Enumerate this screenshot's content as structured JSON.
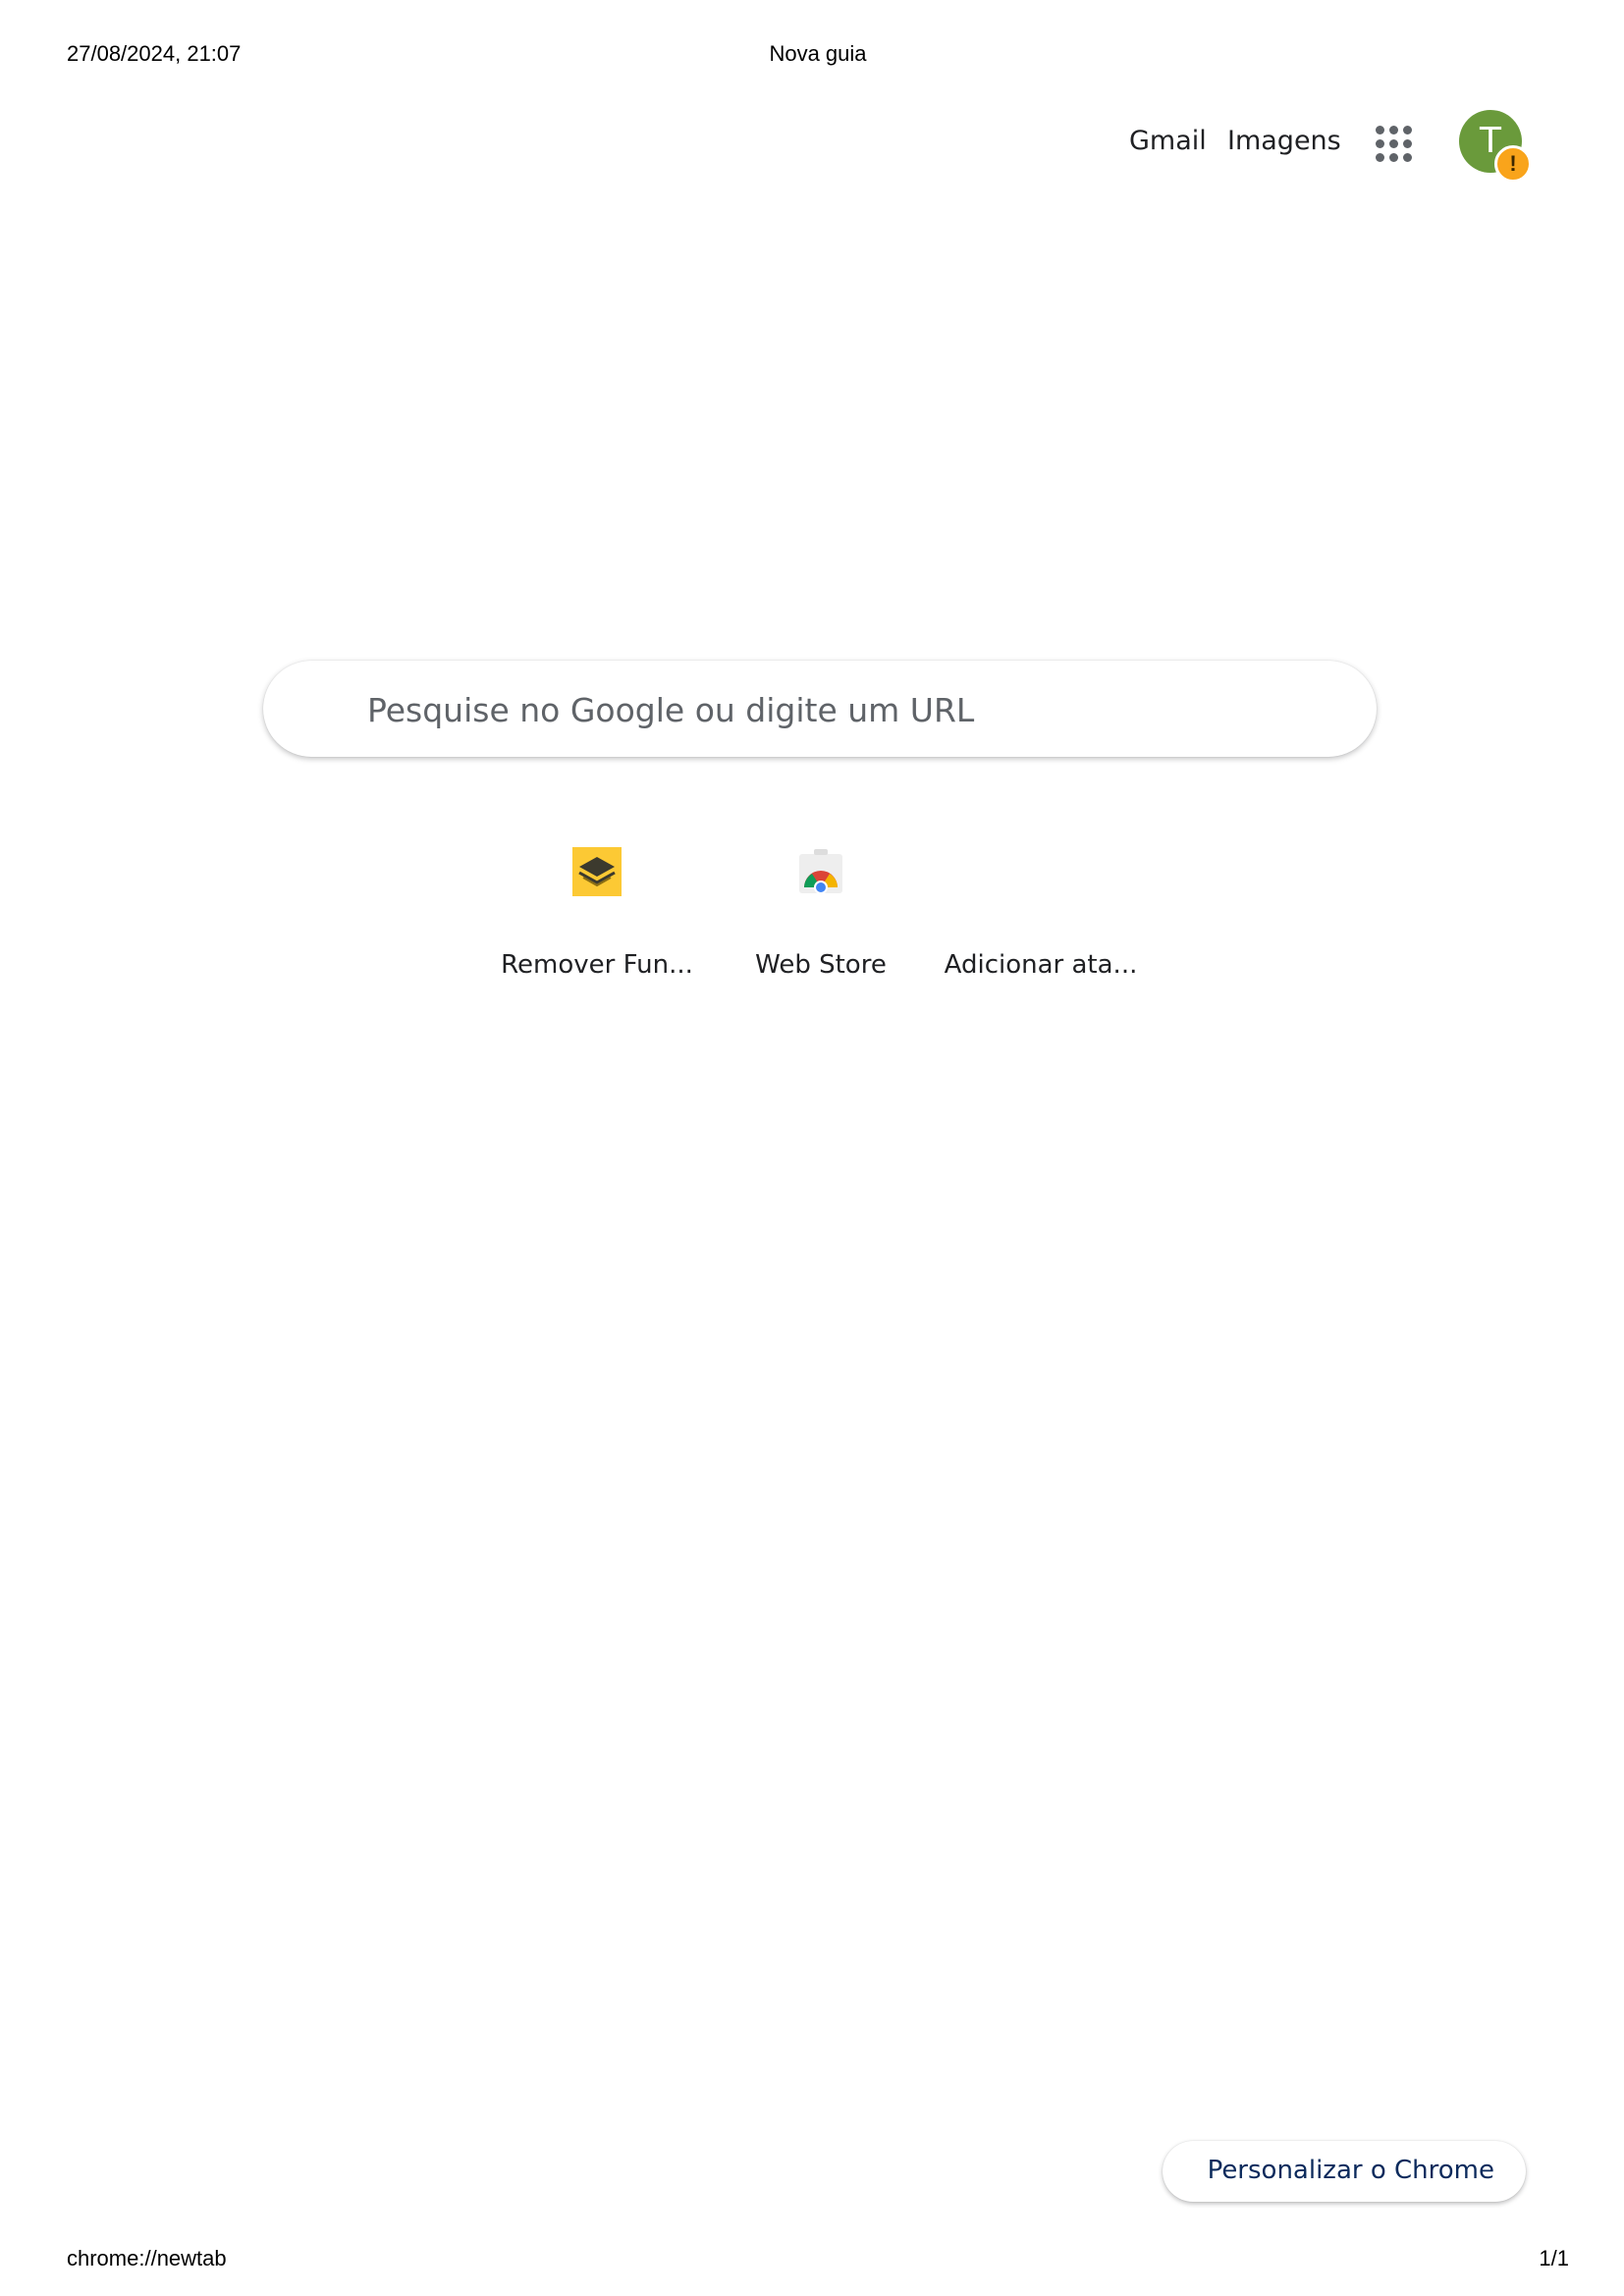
{
  "print_header": {
    "datetime": "27/08/2024, 21:07",
    "page_title": "Nova guia"
  },
  "top_bar": {
    "gmail_label": "Gmail",
    "images_label": "Imagens",
    "apps_icon": "apps-grid-icon",
    "avatar_initial": "T",
    "avatar_color": "#6a9a3b",
    "avatar_badge": "!",
    "avatar_badge_color": "#f9a41b"
  },
  "search": {
    "placeholder": "Pesquise no Google ou digite um URL",
    "value": ""
  },
  "shortcuts": [
    {
      "label": "Remover Fun...",
      "icon": "yellow-layers-icon"
    },
    {
      "label": "Web Store",
      "icon": "chrome-web-store-icon"
    },
    {
      "label": "Adicionar ata...",
      "icon": ""
    }
  ],
  "customize": {
    "label": "Personalizar o Chrome"
  },
  "print_footer": {
    "url": "chrome://newtab",
    "page_number": "1/1"
  }
}
